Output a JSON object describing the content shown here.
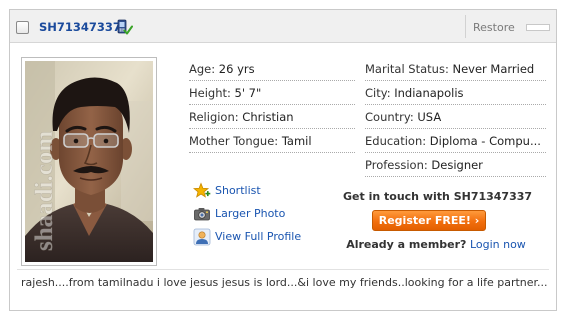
{
  "header": {
    "profile_id": "SH71347337",
    "restore_label": "Restore",
    "mobile_verified_icon": "phone-check-icon"
  },
  "photo": {
    "watermark": "shaadi.com",
    "alt": "profile photo"
  },
  "details": {
    "left": [
      {
        "label": "Age:",
        "value": "26 yrs"
      },
      {
        "label": "Height:",
        "value": "5' 7\""
      },
      {
        "label": "Religion:",
        "value": "Christian"
      },
      {
        "label": "Mother Tongue:",
        "value": "Tamil"
      }
    ],
    "right": [
      {
        "label": "Marital Status:",
        "value": "Never Married"
      },
      {
        "label": "City:",
        "value": "Indianapolis"
      },
      {
        "label": "Country:",
        "value": "USA"
      },
      {
        "label": "Education:",
        "value": "Diploma - Compu..."
      },
      {
        "label": "Profession:",
        "value": "Designer"
      }
    ]
  },
  "actions": {
    "shortlist": "Shortlist",
    "larger_photo": "Larger Photo",
    "full_profile": "View Full Profile",
    "icons": {
      "shortlist": "star-plus-icon",
      "larger_photo": "camera-icon",
      "full_profile": "person-icon"
    }
  },
  "contact": {
    "heading": "Get in touch with SH71347337",
    "register_button": "Register FREE! ›",
    "member_text": "Already a member?",
    "login_link": "Login now"
  },
  "description": "rajesh....from tamilnadu i love jesus jesus is lord...&i love my friends..looking for a life partner...",
  "colors": {
    "link": "#1a55b0",
    "id_link": "#1a4a9c",
    "accent_orange": "#f26f0e",
    "header_bg": "#f0f0f0"
  }
}
